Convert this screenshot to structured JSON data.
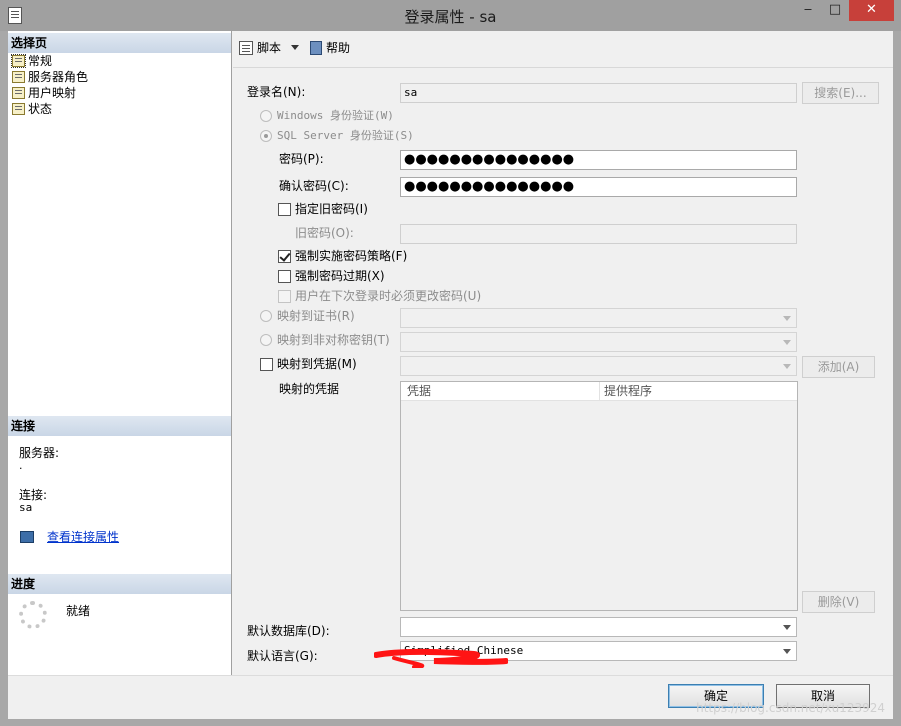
{
  "window": {
    "title": "登录属性 - sa",
    "minimize": "‒",
    "maximize": "□",
    "close": "✕"
  },
  "left": {
    "select_page_header": "选择页",
    "pages": [
      "常规",
      "服务器角色",
      "用户映射",
      "状态"
    ],
    "connection_header": "连接",
    "server_label": "服务器:",
    "server_value": ".",
    "connection_label": "连接:",
    "connection_value": "sa",
    "view_connection_link": "查看连接属性",
    "progress_header": "进度",
    "progress_status": "就绪"
  },
  "toolbar": {
    "script": "脚本",
    "help": "帮助"
  },
  "form": {
    "login_name_label": "登录名(N):",
    "login_name_value": "sa",
    "search_button": "搜索(E)...",
    "windows_auth": "Windows 身份验证(W)",
    "sql_auth": "SQL Server 身份验证(S)",
    "password_label": "密码(P):",
    "password_value": "●●●●●●●●●●●●●●●",
    "confirm_password_label": "确认密码(C):",
    "confirm_password_value": "●●●●●●●●●●●●●●●",
    "specify_old_password": "指定旧密码(I)",
    "old_password_label": "旧密码(O):",
    "enforce_policy": "强制实施密码策略(F)",
    "enforce_expiration": "强制密码过期(X)",
    "must_change": "用户在下次登录时必须更改密码(U)",
    "map_certificate": "映射到证书(R)",
    "map_asymmetric_key": "映射到非对称密钥(T)",
    "map_credential": "映射到凭据(M)",
    "add_button": "添加(A)",
    "mapped_credentials_label": "映射的凭据",
    "grid_columns": [
      "凭据",
      "提供程序"
    ],
    "remove_button": "删除(V)",
    "default_database_label": "默认数据库(D):",
    "default_language_label": "默认语言(G):",
    "default_language_value": "Simplified Chinese",
    "password_policy_checked": true,
    "expiration_checked": false
  },
  "footer": {
    "ok": "确定",
    "cancel": "取消",
    "watermark": "https://blog.csdn.net/xu123924"
  },
  "colors": {
    "section_header": "#c9d6e6",
    "link": "#0033cc",
    "close_button": "#c7403a",
    "redaction": "#ff1414"
  }
}
